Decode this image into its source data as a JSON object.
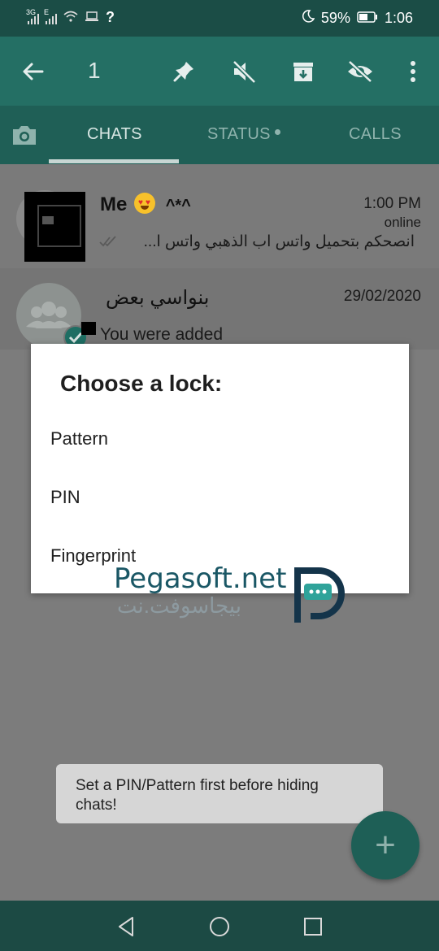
{
  "status_bar": {
    "network_1": "3G",
    "network_2": "E",
    "battery_percent": "59%",
    "time": "1:06"
  },
  "app_bar": {
    "selected_count": "1",
    "icons": [
      "back-arrow-icon",
      "pin-icon",
      "mute-icon",
      "archive-icon",
      "hide-icon",
      "more-vert-icon"
    ]
  },
  "tabs": {
    "chats": "CHATS",
    "status": "STATUS",
    "calls": "CALLS"
  },
  "chats": [
    {
      "name": "Me",
      "name_suffix": "^*^",
      "time": "1:00 PM",
      "presence": "online",
      "message": "انصحكم بتحميل واتس اب الذهبي   واتس ا..."
    },
    {
      "name": "بنواسي بعض",
      "time": "29/02/2020",
      "message": "You were added"
    }
  ],
  "dialog": {
    "title": "Choose a lock:",
    "options": [
      "Pattern",
      "PIN",
      "Fingerprint"
    ]
  },
  "watermark": {
    "english": "Pegasoft.net",
    "arabic": "بيجاسوفت.نت"
  },
  "toast": {
    "message": "Set a PIN/Pattern first before hiding chats!"
  },
  "fab": {
    "label": "+"
  }
}
